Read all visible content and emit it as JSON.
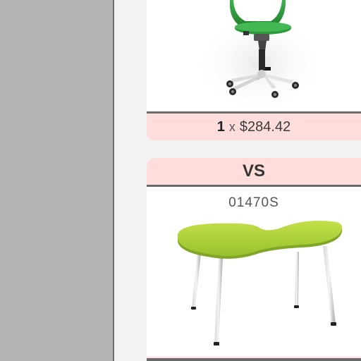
{
  "product_1": {
    "icon": "green-swivel-chair-image",
    "quantity": "1",
    "times_symbol": "x",
    "price": "$284.42"
  },
  "comparison": {
    "separator_label": "VS"
  },
  "product_2": {
    "sku": "01470S",
    "icon": "lime-green-kidney-table-image"
  },
  "colors": {
    "sidebar": "#b3b3b3",
    "price_strip": "#ffdddd",
    "divider": "#6a6a6a",
    "chair_green": "#2f9a3e",
    "table_lime": "#a8cc3a"
  }
}
